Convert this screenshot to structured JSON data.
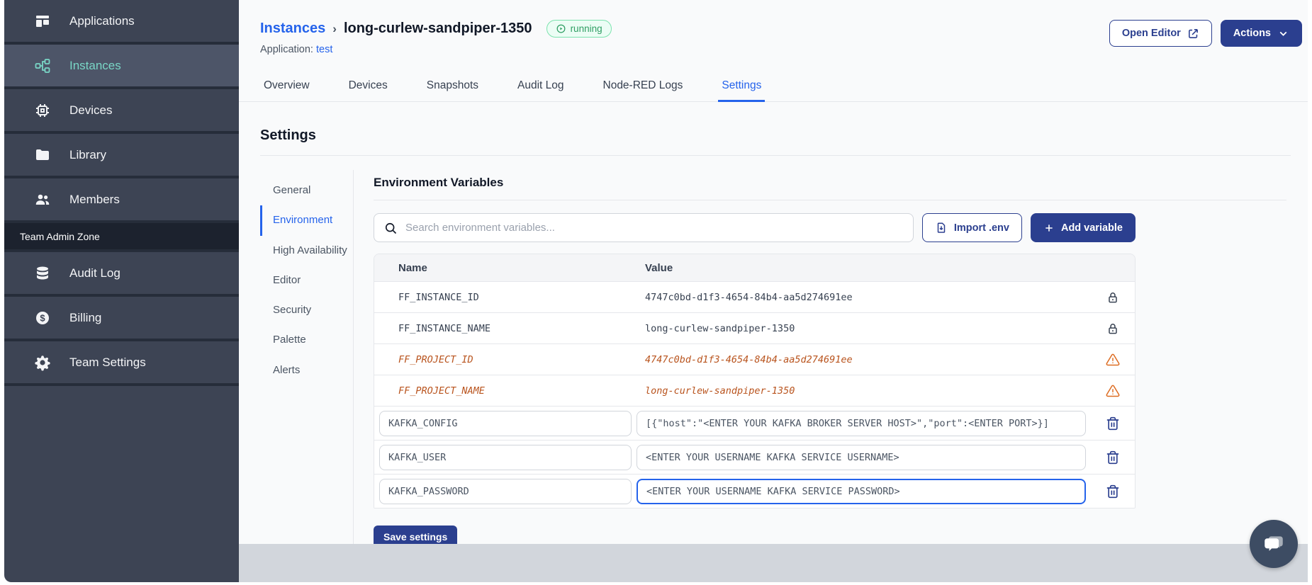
{
  "sidebar": {
    "main_items": [
      {
        "label": "Applications",
        "icon": "applications-icon",
        "active": false
      },
      {
        "label": "Instances",
        "icon": "instances-icon",
        "active": true
      },
      {
        "label": "Devices",
        "icon": "devices-icon",
        "active": false
      },
      {
        "label": "Library",
        "icon": "library-icon",
        "active": false
      },
      {
        "label": "Members",
        "icon": "members-icon",
        "active": false
      }
    ],
    "section_label": "Team Admin Zone",
    "admin_items": [
      {
        "label": "Audit Log",
        "icon": "audit-log-icon",
        "active": false
      },
      {
        "label": "Billing",
        "icon": "billing-icon",
        "active": false
      },
      {
        "label": "Team Settings",
        "icon": "team-settings-icon",
        "active": false
      }
    ]
  },
  "header": {
    "breadcrumb": "Instances",
    "separator": "›",
    "instance_name": "long-curlew-sandpiper-1350",
    "status": "running",
    "application_label": "Application:",
    "application_name": "test",
    "open_editor": "Open Editor",
    "actions": "Actions"
  },
  "tabs": [
    {
      "label": "Overview",
      "active": false
    },
    {
      "label": "Devices",
      "active": false
    },
    {
      "label": "Snapshots",
      "active": false
    },
    {
      "label": "Audit Log",
      "active": false
    },
    {
      "label": "Node-RED Logs",
      "active": false
    },
    {
      "label": "Settings",
      "active": true
    }
  ],
  "settings": {
    "title": "Settings",
    "nav": [
      {
        "label": "General",
        "active": false
      },
      {
        "label": "Environment",
        "active": true
      },
      {
        "label": "High Availability",
        "active": false
      },
      {
        "label": "Editor",
        "active": false
      },
      {
        "label": "Security",
        "active": false
      },
      {
        "label": "Palette",
        "active": false
      },
      {
        "label": "Alerts",
        "active": false
      }
    ]
  },
  "environment": {
    "title": "Environment Variables",
    "search_placeholder": "Search environment variables...",
    "import_button": "Import .env",
    "add_button": "Add variable",
    "columns": {
      "name": "Name",
      "value": "Value"
    },
    "rows": [
      {
        "name": "FF_INSTANCE_ID",
        "value": "4747c0bd-d1f3-4654-84b4-aa5d274691ee",
        "type": "locked",
        "focused": false
      },
      {
        "name": "FF_INSTANCE_NAME",
        "value": "long-curlew-sandpiper-1350",
        "type": "locked",
        "focused": false
      },
      {
        "name": "FF_PROJECT_ID",
        "value": "4747c0bd-d1f3-4654-84b4-aa5d274691ee",
        "type": "deprecated",
        "focused": false
      },
      {
        "name": "FF_PROJECT_NAME",
        "value": "long-curlew-sandpiper-1350",
        "type": "deprecated",
        "focused": false
      },
      {
        "name": "KAFKA_CONFIG",
        "value": "[{\"host\":\"<ENTER YOUR KAFKA BROKER SERVER HOST>\",\"port\":<ENTER PORT>}]",
        "type": "editable",
        "focused": false
      },
      {
        "name": "KAFKA_USER",
        "value": "<ENTER YOUR USERNAME KAFKA SERVICE USERNAME>",
        "type": "editable",
        "focused": false
      },
      {
        "name": "KAFKA_PASSWORD",
        "value": "<ENTER YOUR USERNAME KAFKA SERVICE PASSWORD>",
        "type": "editable",
        "focused": true
      }
    ],
    "save_button": "Save settings"
  },
  "colors": {
    "navy": "#2b3f8f",
    "accent_blue": "#2563eb",
    "sidebar_bg": "#3d4454",
    "sidebar_active_text": "#79d6c6",
    "status_green": "#2f9e63",
    "deprecated_orange": "#b9541e",
    "bottom_strip": "#d2d6dc"
  }
}
